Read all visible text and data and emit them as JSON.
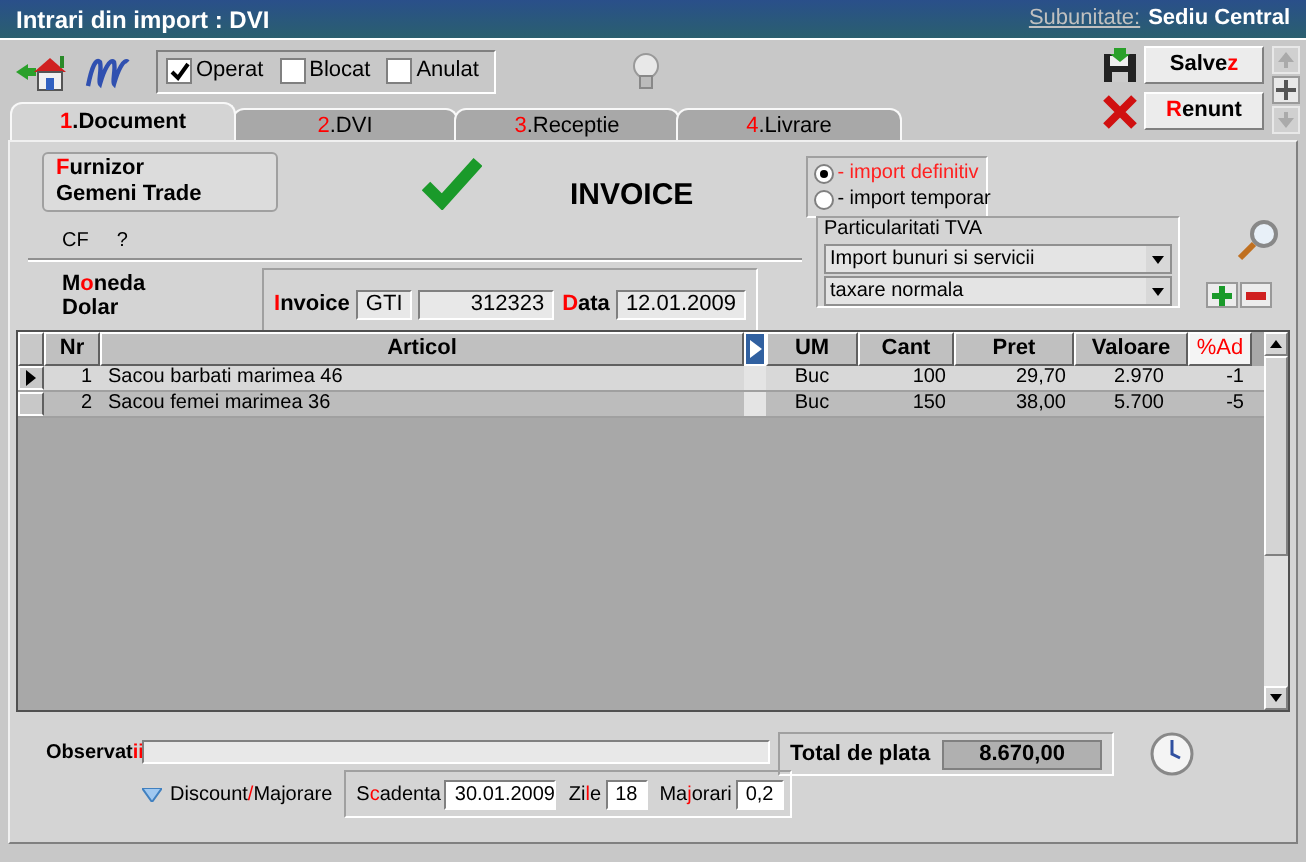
{
  "window": {
    "title": "Intrari din import : DVI",
    "subunit_label": "Subunitate:",
    "subunit": "Sediu Central"
  },
  "flags": [
    {
      "label": "Operat",
      "checked": true
    },
    {
      "label": "Blocat",
      "checked": false
    },
    {
      "label": "Anulat",
      "checked": false
    }
  ],
  "actions": [
    {
      "kind": "save",
      "label": {
        "pre": "Salve",
        "key": "z"
      }
    },
    {
      "kind": "cancel",
      "label": {
        "key": "R",
        "post": "enunt"
      }
    }
  ],
  "tabs": [
    {
      "num": "1",
      "label": ".Document",
      "selected": true
    },
    {
      "num": "2",
      "label": ".DVI",
      "selected": false
    },
    {
      "num": "3",
      "label": ".Receptie",
      "selected": false
    },
    {
      "num": "4",
      "label": ".Livrare",
      "selected": false
    }
  ],
  "supplier": {
    "label": {
      "key": "F",
      "post": "urnizor"
    },
    "value": "Gemeni Trade"
  },
  "cf": {
    "label": "CF",
    "value": "?"
  },
  "doc_type": "INVOICE",
  "import_type": [
    {
      "label": "- import definitiv",
      "selected": true
    },
    {
      "label": "- import temporar",
      "selected": false
    }
  ],
  "currency": {
    "label": {
      "pre": "M",
      "key": "o",
      "post": "neda"
    },
    "value": "Dolar"
  },
  "invoice": {
    "label": {
      "key": "I",
      "post": "nvoice"
    },
    "series": "GTI",
    "number": "312323",
    "date_label": {
      "key": "D",
      "post": "ata"
    },
    "date": "12.01.2009"
  },
  "vat": {
    "title": "Particularitati TVA",
    "selects": [
      "Import bunuri si servicii",
      "taxare normala"
    ]
  },
  "table": {
    "columns": [
      {
        "label": "Nr",
        "highlight": false
      },
      {
        "label": "Articol",
        "highlight": false
      },
      {
        "label": "UM",
        "highlight": false
      },
      {
        "label": "Cant",
        "highlight": false
      },
      {
        "label": "Pret",
        "highlight": false
      },
      {
        "label": "Valoare",
        "highlight": false
      },
      {
        "label": "%Ad",
        "highlight": true
      }
    ],
    "rows": [
      {
        "selected": true,
        "cells": [
          "1",
          "Sacou barbati marimea 46",
          "Buc",
          "100",
          "29,70",
          "2.970",
          "-1"
        ]
      },
      {
        "selected": false,
        "cells": [
          "2",
          "Sacou femei marimea 36",
          "Buc",
          "150",
          "38,00",
          "5.700",
          "-5"
        ]
      }
    ]
  },
  "observations": {
    "label": {
      "pre": "Observat",
      "key": "ii"
    }
  },
  "total": {
    "label": "Total de plata",
    "value": "8.670,00"
  },
  "discount": {
    "pre": "Discount",
    "key": "/",
    "post": "Majorare"
  },
  "terms": {
    "due_label": {
      "pre": "S",
      "key": "c",
      "post": "adenta"
    },
    "due": "30.01.2009",
    "days_label": {
      "pre": "Zi",
      "key": "l",
      "post": "e"
    },
    "days": "18",
    "penalty_label": {
      "pre": "Ma",
      "key": "j",
      "post": "orari"
    },
    "penalty": "0,2"
  }
}
